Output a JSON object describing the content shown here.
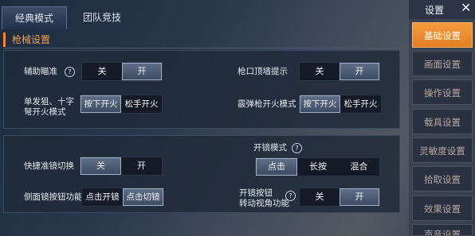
{
  "tabs": [
    "经典模式",
    "团队竞技"
  ],
  "section_title": "枪械设置",
  "settings": {
    "aim_assist": {
      "label": "辅助瞄准",
      "help": "?",
      "options": [
        "关",
        "开"
      ],
      "selected": "开"
    },
    "muzzle_hint": {
      "label": "枪口顶墙提示",
      "options": [
        "关",
        "开"
      ],
      "selected": "开"
    },
    "single_fire": {
      "label_line1": "单发狙、十字",
      "label_line2": "弩开火模式",
      "options": [
        "按下开火",
        "松手开火"
      ],
      "selected": "按下开火"
    },
    "shotgun_fire": {
      "label": "霰弹枪开火模式",
      "options": [
        "按下开火",
        "松手开火"
      ],
      "selected": "按下开火"
    },
    "quick_scope": {
      "label": "快捷准镜切换",
      "options": [
        "关",
        "开"
      ],
      "selected": "关"
    },
    "scope_mode": {
      "label": "开镜模式",
      "help": "?",
      "options": [
        "点击",
        "长按",
        "混合"
      ],
      "selected": "点击"
    },
    "side_button": {
      "label": "侧面镜按钮功能",
      "options": [
        "点击开镜",
        "点击切镜"
      ],
      "selected": "点击切镜"
    },
    "scope_view": {
      "label_line1": "开镜按钮",
      "label_line2": "转动视角功能",
      "help": "?",
      "options": [
        "关",
        "开"
      ],
      "selected": "开"
    }
  },
  "sidebar": {
    "title": "设置",
    "close_icon": "close-icon",
    "items": [
      "基础设置",
      "画面设置",
      "操作设置",
      "载具设置",
      "灵敏度设置",
      "拾取设置",
      "效果设置",
      "声音设置"
    ],
    "active": "基础设置"
  },
  "colors": {
    "accent": "#f08a2c",
    "panel": "#202a3a"
  }
}
